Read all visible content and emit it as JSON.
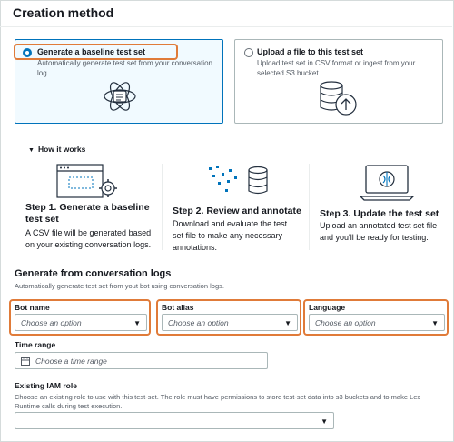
{
  "header": {
    "title": "Creation method"
  },
  "options": [
    {
      "title": "Generate a baseline test set",
      "description": "Automatically generate test set from your conversation log.",
      "selected": true
    },
    {
      "title": "Upload a file to this test set",
      "description": "Upload test set in CSV format or ingest from your selected S3 bucket.",
      "selected": false
    }
  ],
  "how_it_works": {
    "toggle_label": "How it works",
    "steps": [
      {
        "title": "Step 1. Generate a baseline test set",
        "description": "A CSV file will be generated based on your existing conversation logs."
      },
      {
        "title": "Step 2. Review and annotate",
        "description": "Download and evaluate the test set file to make any necessary annotations."
      },
      {
        "title": "Step 3. Update the test set",
        "description": "Upload an annotated test set file and you'll be ready for testing."
      }
    ]
  },
  "generate": {
    "title": "Generate from conversation logs",
    "description": "Automatically generate test set from yout bot using conversation logs.",
    "fields": [
      {
        "label": "Bot name",
        "placeholder": "Choose an option"
      },
      {
        "label": "Bot alias",
        "placeholder": "Choose an option"
      },
      {
        "label": "Language",
        "placeholder": "Choose an option"
      }
    ],
    "time_range": {
      "label": "Time range",
      "placeholder": "Choose a time range"
    },
    "iam": {
      "label": "Existing IAM role",
      "description": "Choose an existing role to use with this test-set. The role must have permissions to store test-set data into s3 buckets and to make Lex Runtime calls during test execution.",
      "placeholder": ""
    }
  },
  "colors": {
    "accent": "#0073bb",
    "highlight": "#e07b39",
    "text": "#16191f",
    "muted": "#545b64"
  }
}
